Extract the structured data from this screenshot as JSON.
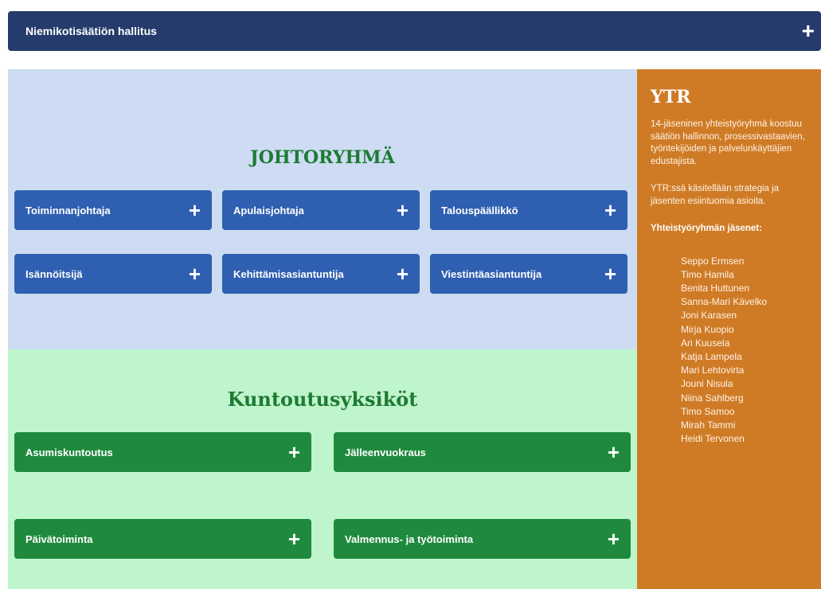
{
  "header": {
    "title": "Niemikotisäätiön hallitus",
    "toggle_symbol": "+"
  },
  "johtoryhma": {
    "title": "JOHTORYHMÄ",
    "buttons": [
      {
        "label": "Toiminnanjohtaja"
      },
      {
        "label": "Apulaisjohtaja"
      },
      {
        "label": "Talouspäällikkö"
      },
      {
        "label": "Isännöitsijä"
      },
      {
        "label": "Kehittämisasiantuntija"
      },
      {
        "label": "Viestintäasiantuntija"
      }
    ]
  },
  "kuntoutusyksikot": {
    "title": "Kuntoutusyksiköt",
    "buttons": [
      {
        "label": "Asumiskuntoutus"
      },
      {
        "label": "Jälleenvuokraus"
      },
      {
        "label": "Päivätoiminta"
      },
      {
        "label": "Valmennus- ja työtoiminta"
      }
    ]
  },
  "ytr": {
    "title": "YTR",
    "description": "14-jäseninen yhteistyöryhmä koostuu säätiön hallinnon, prosessivastaavien, työntekijöiden ja palvelunkäyttäjien edustajista.",
    "purpose": "YTR:ssä käsitellään strategia ja jäsenten esiintuomia asioita.",
    "members_heading": "Yhteistyöryhmän jäsenet:",
    "members": [
      "Seppo Ermsen",
      "Timo Hamila",
      "Benita Huttunen",
      "Sanna-Mari Kävelko",
      "Joni Karasen",
      "Mirja Kuopio",
      "Ari Kuusela",
      "Katja Lampela",
      "Mari Lehtovirta",
      "Jouni Nisula",
      "Niina Sahlberg",
      "Timo Samoo",
      "Mirah Tammi",
      "Heidi Tervonen"
    ]
  },
  "colors": {
    "header_bg": "#243b6b",
    "johto_bg": "#cddcf2",
    "kunto_bg": "#bff5cd",
    "blue_button": "#2f5fb0",
    "green_button": "#1f8a3d",
    "ytr_bg": "#cf7b26",
    "section_title": "#1e7a34"
  },
  "icons": {
    "expand": "plus-icon"
  }
}
